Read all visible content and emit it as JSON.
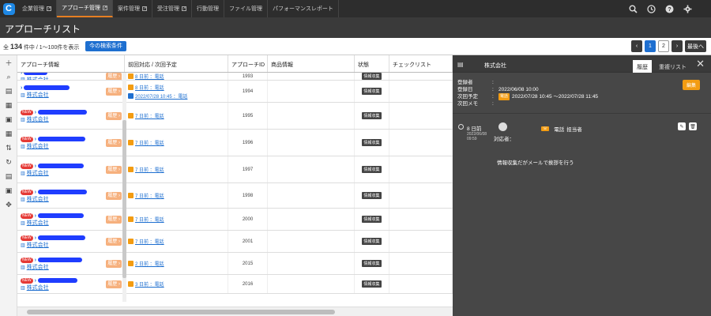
{
  "nav": {
    "logo": "C",
    "tabs": [
      {
        "label": "企業管理",
        "active": false
      },
      {
        "label": "アプローチ管理",
        "active": true
      },
      {
        "label": "案件管理",
        "active": false
      },
      {
        "label": "受注管理",
        "active": false
      },
      {
        "label": "行動管理",
        "active": false
      },
      {
        "label": "ファイル管理",
        "active": false
      },
      {
        "label": "パフォーマンスレポート",
        "active": false
      }
    ]
  },
  "page": {
    "title": "アプローチリスト"
  },
  "counter": {
    "prefix": "全",
    "total": "134",
    "suffix": "件中 / 1～100件を表示",
    "search_button": "今の検索条件"
  },
  "pager": {
    "prev": "‹",
    "pages": [
      "1",
      "2"
    ],
    "current": "1",
    "next": "›",
    "last": "最後へ"
  },
  "table": {
    "headers": [
      "アプローチ情報",
      "前回対応 / 次回予定",
      "アプローチID",
      "商品情報",
      "状態",
      "チェックリスト"
    ],
    "rows": [
      {
        "company": "株式会社",
        "new": false,
        "hist": "履歴",
        "act": "8 日前 ：電話",
        "next": "",
        "id": "1993",
        "status": "情報収集"
      },
      {
        "company": "株式会社",
        "new": false,
        "hist": "履歴",
        "act": "8 日前 ：電話",
        "next": "2022/07/28 10:45 ：電話",
        "id": "1994",
        "status": "情報収集"
      },
      {
        "company": "株式会社",
        "new": true,
        "hist": "履歴",
        "act": "7 日前 ：電話",
        "next": "",
        "id": "1995",
        "status": "情報収集"
      },
      {
        "company": "株式会社",
        "new": true,
        "hist": "履歴",
        "act": "7 日前 ：電話",
        "next": "",
        "id": "1996",
        "status": "情報収集"
      },
      {
        "company": "株式会社",
        "new": true,
        "hist": "履歴",
        "act": "7 日前 ：電話",
        "next": "",
        "id": "1997",
        "status": "情報収集"
      },
      {
        "company": "株式会社",
        "new": true,
        "hist": "履歴",
        "act": "7 日前 ：電話",
        "next": "",
        "id": "1998",
        "status": "情報収集"
      },
      {
        "company": "株式会社",
        "new": true,
        "hist": "履歴",
        "act": "7 日前 ：電話",
        "next": "",
        "id": "2000",
        "status": "情報収集"
      },
      {
        "company": "株式会社",
        "new": true,
        "hist": "履歴",
        "act": "7 日前 ：電話",
        "next": "",
        "id": "2001",
        "status": "情報収集"
      },
      {
        "company": "株式会社",
        "new": true,
        "hist": "履歴",
        "act": "2 日前 ：電話",
        "next": "",
        "id": "2015",
        "status": "情報収集"
      },
      {
        "company": "株式会社",
        "new": true,
        "hist": "履歴",
        "act": "3 日前 ：電話",
        "next": "",
        "id": "2016",
        "status": "情報収集"
      }
    ]
  },
  "panel": {
    "title": "株式会社",
    "tabs": [
      "履歴",
      "重複リスト"
    ],
    "info": {
      "registrant_label": "登録者",
      "registrant_value": "",
      "reg_date_label": "登録日",
      "reg_date_value": "2022/06/08 10:00",
      "next_label": "次回予定",
      "next_tag": "電話",
      "next_value": "2022/07/28 10:45 ～2022/07/28 11:45",
      "memo_label": "次回メモ",
      "memo_value": ""
    },
    "edit_button": "編集",
    "entry": {
      "days": "8 日前",
      "date": "2022/06/08",
      "time": "09:59",
      "responder": "対応者：",
      "type": "電話",
      "role": "担当者",
      "memo": "情報収集だがメールで挨拶を行う"
    }
  }
}
